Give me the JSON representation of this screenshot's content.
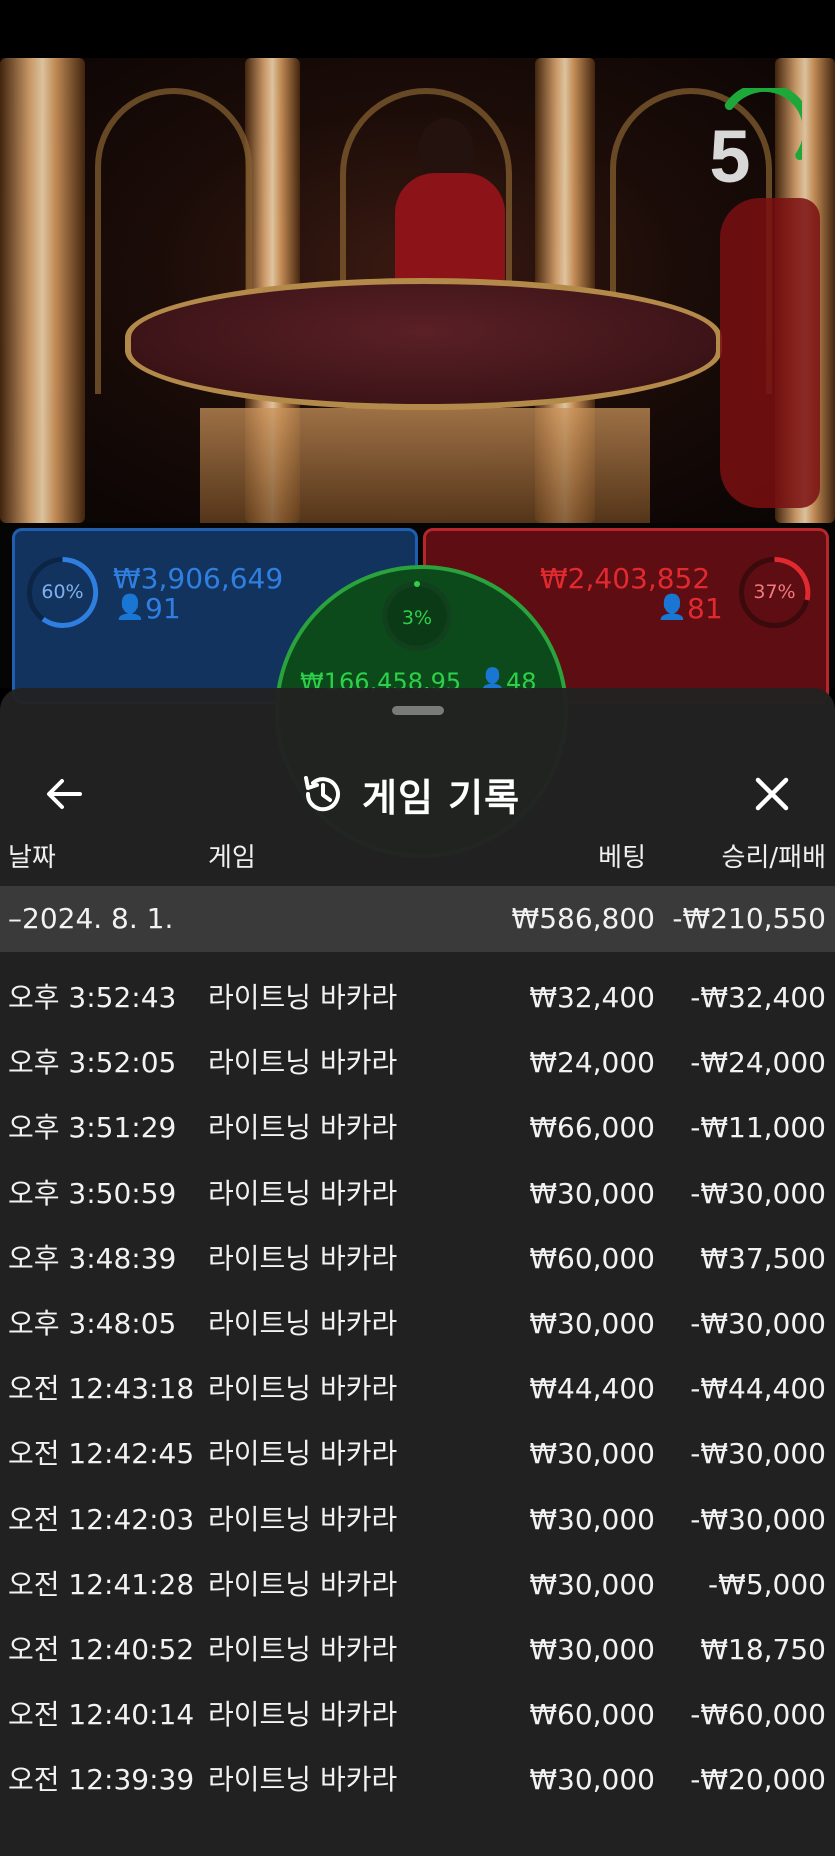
{
  "game": {
    "countdown": "5",
    "player": {
      "percent": "60%",
      "amount": "₩3,906,649",
      "count": "91",
      "color": "#2f7fe0"
    },
    "banker": {
      "percent": "37%",
      "amount": "₩2,403,852",
      "count": "81",
      "color": "#e02a30"
    },
    "tie": {
      "percent": "3%",
      "amount": "₩166,458.95",
      "count": "48",
      "color": "#2ed04a"
    }
  },
  "sheet": {
    "title": "게임 기록",
    "back_icon": "arrow-left-icon",
    "title_icon": "history-icon",
    "close_icon": "close-icon",
    "columns": {
      "date": "날짜",
      "game": "게임",
      "bet": "베팅",
      "result": "승리/패배"
    },
    "summary": {
      "date": "–2024. 8. 1.",
      "bet": "₩586,800",
      "result": "-₩210,550"
    },
    "rows": [
      {
        "time": "오후 3:52:43",
        "game": "라이트닝 바카라",
        "bet": "₩32,400",
        "result": "-₩32,400"
      },
      {
        "time": "오후 3:52:05",
        "game": "라이트닝 바카라",
        "bet": "₩24,000",
        "result": "-₩24,000"
      },
      {
        "time": "오후 3:51:29",
        "game": "라이트닝 바카라",
        "bet": "₩66,000",
        "result": "-₩11,000"
      },
      {
        "time": "오후 3:50:59",
        "game": "라이트닝 바카라",
        "bet": "₩30,000",
        "result": "-₩30,000"
      },
      {
        "time": "오후 3:48:39",
        "game": "라이트닝 바카라",
        "bet": "₩60,000",
        "result": "₩37,500"
      },
      {
        "time": "오후 3:48:05",
        "game": "라이트닝 바카라",
        "bet": "₩30,000",
        "result": "-₩30,000"
      },
      {
        "time": "오전 12:43:18",
        "game": "라이트닝 바카라",
        "bet": "₩44,400",
        "result": "-₩44,400"
      },
      {
        "time": "오전 12:42:45",
        "game": "라이트닝 바카라",
        "bet": "₩30,000",
        "result": "-₩30,000"
      },
      {
        "time": "오전 12:42:03",
        "game": "라이트닝 바카라",
        "bet": "₩30,000",
        "result": "-₩30,000"
      },
      {
        "time": "오전 12:41:28",
        "game": "라이트닝 바카라",
        "bet": "₩30,000",
        "result": "-₩5,000"
      },
      {
        "time": "오전 12:40:52",
        "game": "라이트닝 바카라",
        "bet": "₩30,000",
        "result": "₩18,750"
      },
      {
        "time": "오전 12:40:14",
        "game": "라이트닝 바카라",
        "bet": "₩60,000",
        "result": "-₩60,000"
      },
      {
        "time": "오전 12:39:39",
        "game": "라이트닝 바카라",
        "bet": "₩30,000",
        "result": "-₩20,000"
      }
    ]
  }
}
